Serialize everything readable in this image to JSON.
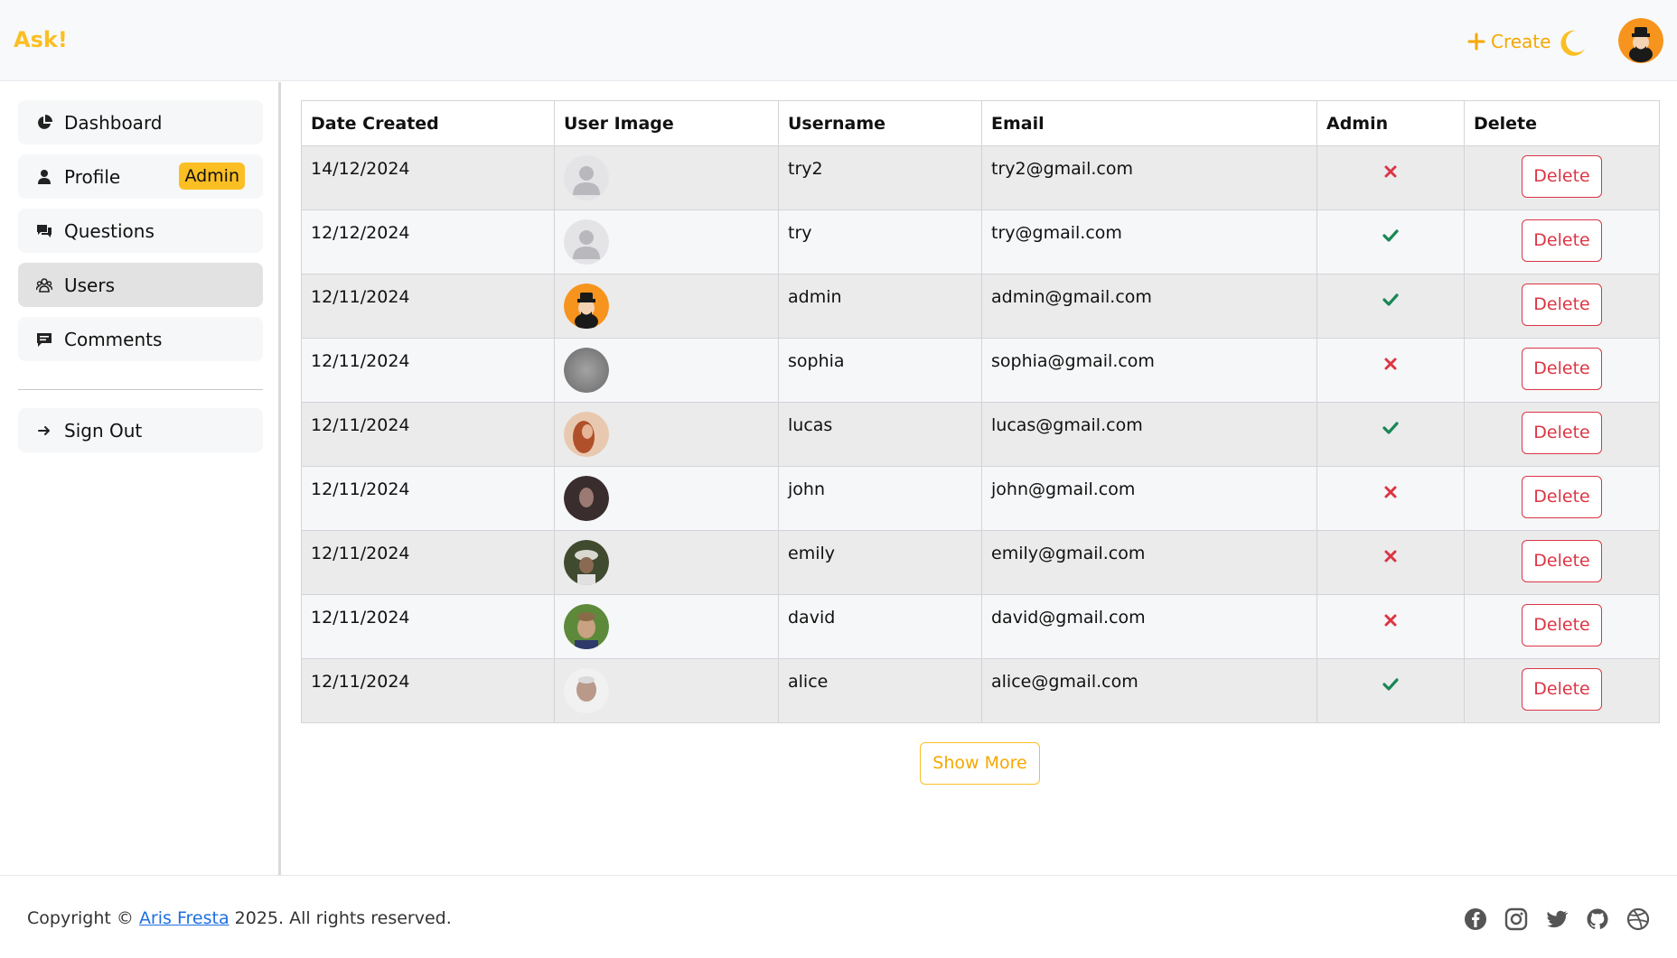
{
  "header": {
    "brand": "Ask!",
    "create_label": "Create"
  },
  "sidebar": {
    "items": [
      {
        "label": "Dashboard",
        "icon": "pie-chart-icon"
      },
      {
        "label": "Profile",
        "icon": "user-icon",
        "badge": "Admin"
      },
      {
        "label": "Questions",
        "icon": "chat-bubbles-icon"
      },
      {
        "label": "Users",
        "icon": "users-group-icon",
        "active": true
      },
      {
        "label": "Comments",
        "icon": "comment-icon"
      }
    ],
    "signout_label": "Sign Out"
  },
  "table": {
    "headers": [
      "Date Created",
      "User Image",
      "Username",
      "Email",
      "Admin",
      "Delete"
    ],
    "rows": [
      {
        "date": "14/12/2024",
        "username": "try2",
        "email": "try2@gmail.com",
        "admin": false,
        "delete_label": "Delete"
      },
      {
        "date": "12/12/2024",
        "username": "try",
        "email": "try@gmail.com",
        "admin": true,
        "delete_label": "Delete"
      },
      {
        "date": "12/11/2024",
        "username": "admin",
        "email": "admin@gmail.com",
        "admin": true,
        "delete_label": "Delete"
      },
      {
        "date": "12/11/2024",
        "username": "sophia",
        "email": "sophia@gmail.com",
        "admin": false,
        "delete_label": "Delete"
      },
      {
        "date": "12/11/2024",
        "username": "lucas",
        "email": "lucas@gmail.com",
        "admin": true,
        "delete_label": "Delete"
      },
      {
        "date": "12/11/2024",
        "username": "john",
        "email": "john@gmail.com",
        "admin": false,
        "delete_label": "Delete"
      },
      {
        "date": "12/11/2024",
        "username": "emily",
        "email": "emily@gmail.com",
        "admin": false,
        "delete_label": "Delete"
      },
      {
        "date": "12/11/2024",
        "username": "david",
        "email": "david@gmail.com",
        "admin": false,
        "delete_label": "Delete"
      },
      {
        "date": "12/11/2024",
        "username": "alice",
        "email": "alice@gmail.com",
        "admin": true,
        "delete_label": "Delete"
      }
    ]
  },
  "show_more_label": "Show More",
  "footer": {
    "copyright_prefix": "Copyright ©",
    "author": "Aris Fresta",
    "copyright_suffix": "2025. All rights reserved.",
    "social_icons": [
      "facebook-icon",
      "instagram-icon",
      "twitter-icon",
      "github-icon",
      "dribbble-icon"
    ]
  },
  "colors": {
    "accent": "#fbbf24",
    "danger": "#dc3545",
    "success": "#198754",
    "link": "#1d6fe0"
  }
}
